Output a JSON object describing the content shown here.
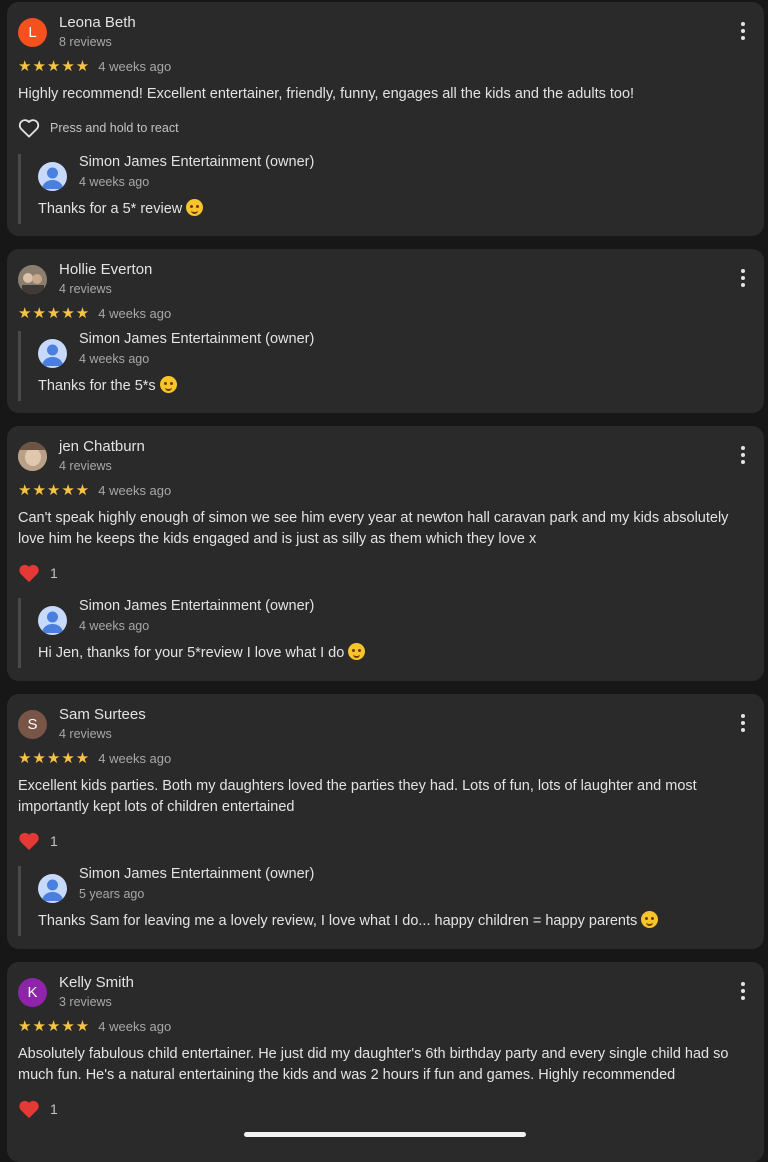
{
  "reviews": [
    {
      "name": "Leona Beth",
      "initial": "L",
      "avatar_color": "#f4511e",
      "count": "8 reviews",
      "stars": "★★★★★",
      "time": "4 weeks ago",
      "text": "Highly recommend! Excellent entertainer, friendly, funny, engages all the kids and the adults too!",
      "react_label": "Press and hold to react",
      "reply": {
        "owner": "Simon James Entertainment (owner)",
        "date": "4 weeks ago",
        "text": "Thanks for a 5* review"
      }
    },
    {
      "name": "Hollie Everton",
      "count": "4 reviews",
      "stars": "★★★★★",
      "time": "4 weeks ago",
      "reply": {
        "owner": "Simon James Entertainment (owner)",
        "date": "4 weeks ago",
        "text": "Thanks for the 5*s"
      }
    },
    {
      "name": "jen Chatburn",
      "count": "4 reviews",
      "stars": "★★★★★",
      "time": "4 weeks ago",
      "text": "Can't speak highly enough of simon we see him every year at newton hall caravan park and my kids absolutely love him he keeps the kids engaged and is just as silly as them which they love x",
      "likes": "1",
      "reply": {
        "owner": "Simon James Entertainment (owner)",
        "date": "4 weeks ago",
        "text": "Hi Jen, thanks for your 5*review I love what I do"
      }
    },
    {
      "name": "Sam Surtees",
      "initial": "S",
      "avatar_color": "#795548",
      "count": "4 reviews",
      "stars": "★★★★★",
      "time": "4 weeks ago",
      "text": "Excellent kids parties. Both my daughters loved the parties they had. Lots of fun, lots of laughter and most importantly kept lots of children entertained",
      "likes": "1",
      "reply": {
        "owner": "Simon James Entertainment (owner)",
        "date": "5 years ago",
        "text": "Thanks Sam for leaving me a lovely review, I love what I do... happy children = happy parents"
      }
    },
    {
      "name": "Kelly Smith",
      "initial": "K",
      "avatar_color": "#8e24aa",
      "count": "3 reviews",
      "stars": "★★★★★",
      "time": "4 weeks ago",
      "text": "Absolutely fabulous child entertainer. He just did my daughter's 6th birthday party and every single child had so much fun. He's a natural entertaining the kids and was 2 hours if fun and games. Highly recommended",
      "likes": "1"
    }
  ]
}
